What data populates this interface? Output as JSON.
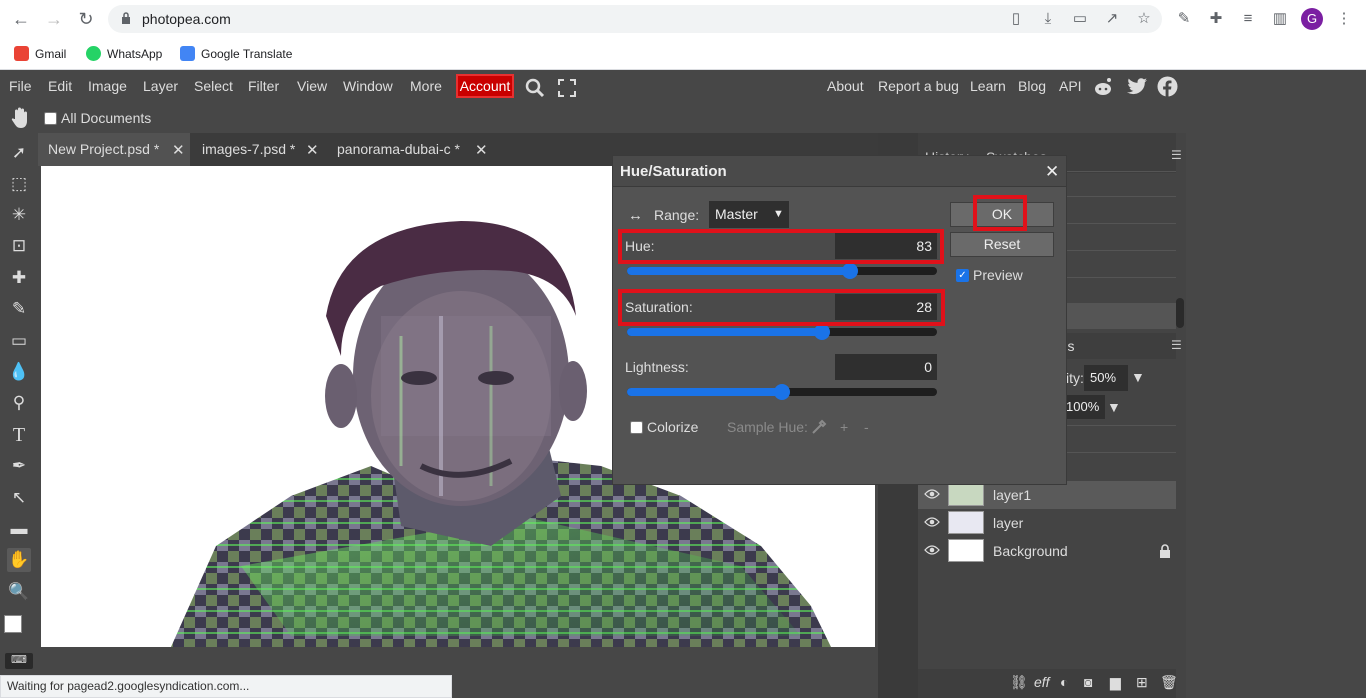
{
  "browser": {
    "url": "photopea.com",
    "bookmarks": [
      "Gmail",
      "WhatsApp",
      "Google Translate"
    ],
    "avatar_letter": "G",
    "status_text": "Waiting for pagead2.googlesyndication.com..."
  },
  "menu": {
    "items": [
      "File",
      "Edit",
      "Image",
      "Layer",
      "Select",
      "Filter",
      "View",
      "Window",
      "More"
    ],
    "account": "Account",
    "right_links": [
      "About",
      "Report a bug",
      "Learn",
      "Blog",
      "API"
    ]
  },
  "options": {
    "all_documents": "All Documents"
  },
  "tabs": [
    {
      "label": "New Project.psd *"
    },
    {
      "label": "images-7.psd *"
    },
    {
      "label": "panorama-dubai-c *"
    }
  ],
  "right_panel": {
    "tab_history": "History",
    "tab_swatches": "Swatches",
    "paths_label": "aths",
    "opacity_label": "ity:",
    "opacity_value": "50%",
    "fill_value": "100%",
    "layers": [
      {
        "name": "layer1",
        "selected": true
      },
      {
        "name": "layer"
      },
      {
        "name": "Background",
        "locked": true
      }
    ]
  },
  "dialog": {
    "title": "Hue/Saturation",
    "range_label": "Range:",
    "range_value": "Master",
    "hue_label": "Hue:",
    "hue_value": "83",
    "saturation_label": "Saturation:",
    "saturation_value": "28",
    "lightness_label": "Lightness:",
    "lightness_value": "0",
    "colorize_label": "Colorize",
    "sample_hue_label": "Sample Hue:",
    "plus": "+",
    "minus": "-",
    "ok_label": "OK",
    "reset_label": "Reset",
    "preview_label": "Preview",
    "preview_checked": true,
    "colorize_checked": false,
    "hue_fraction": 0.72,
    "saturation_fraction": 0.63,
    "lightness_fraction": 0.5
  },
  "colors": {
    "account_bg": "#c90000",
    "highlight": "#e0111a",
    "slider_blue": "#1a73e8"
  }
}
